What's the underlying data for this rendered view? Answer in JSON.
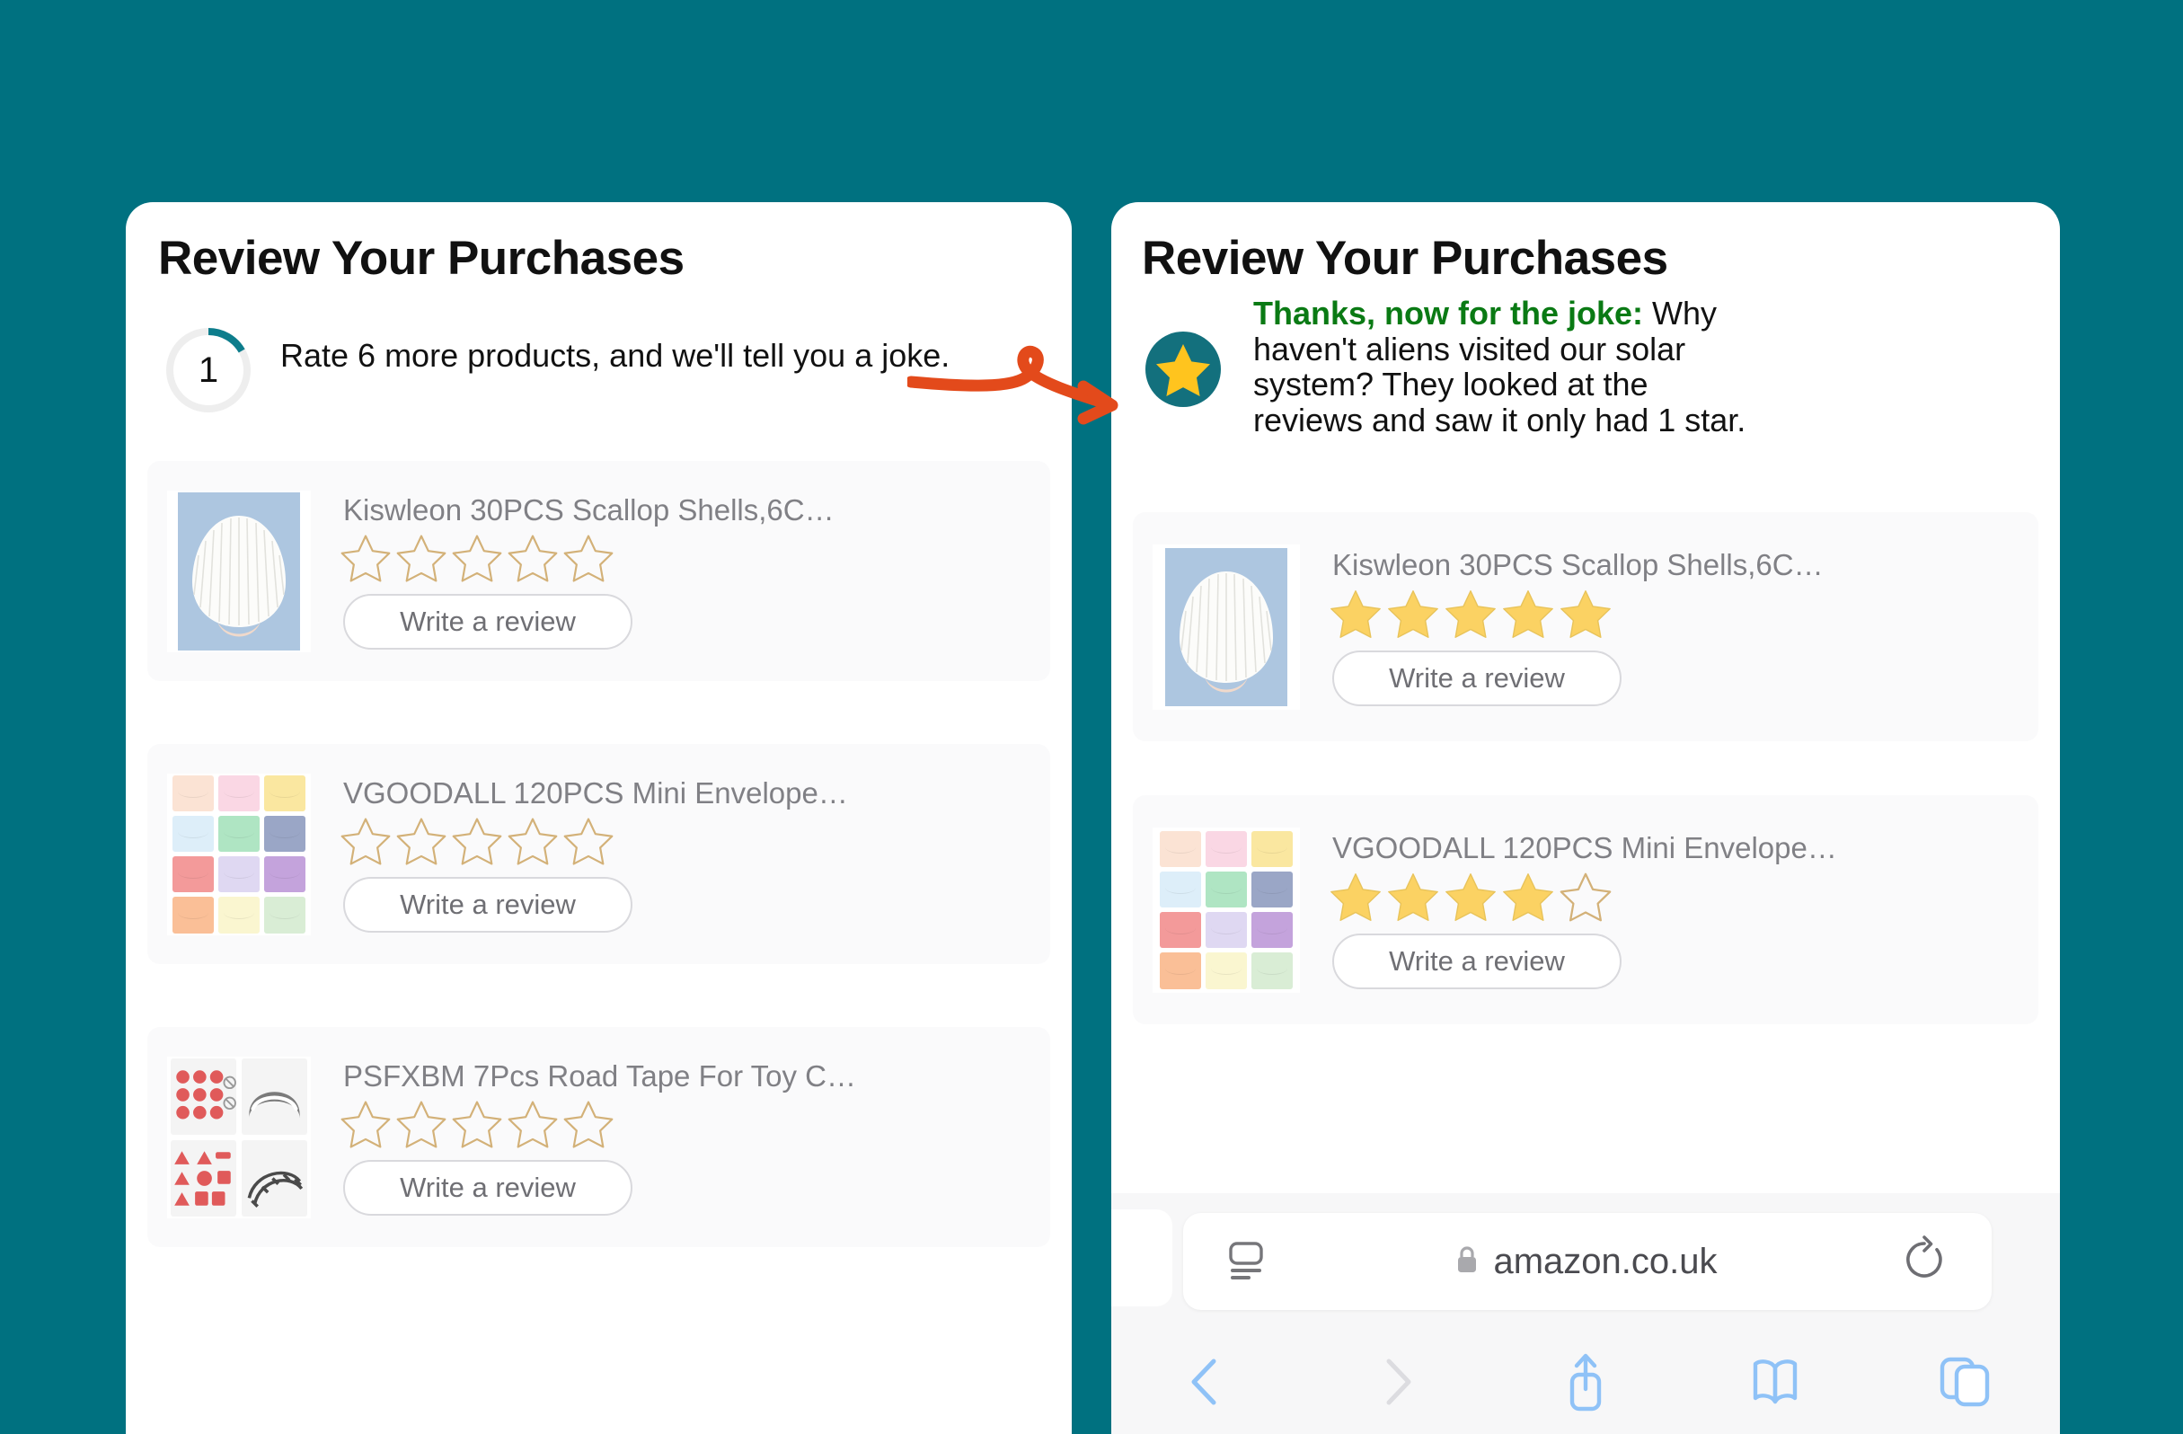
{
  "theme": {
    "background": "#007180",
    "card_background": "#ffffff",
    "item_background": "#FAFAFB",
    "progress_accent": "#0d7d8c",
    "progress_track": "#eeeeee",
    "star_filled": "#FBD263",
    "star_outline": "#D3B178",
    "joke_highlight": "#0a7a14",
    "annotation_arrow": "#E34A1B",
    "badge_circle": "#13707D",
    "badge_star": "#FFC41E",
    "safari_accent": "#8FC2F7"
  },
  "left_panel": {
    "title": "Review Your Purchases",
    "progress": {
      "value": "1",
      "percent": 14,
      "message": "Rate 6 more products, and we'll tell you a joke."
    },
    "products": [
      {
        "name": "Kiswleon 30PCS Scallop Shells,6C…",
        "rating": 0,
        "button": "Write a review",
        "thumb": "scallop-shell"
      },
      {
        "name": "VGOODALL 120PCS Mini Envelope…",
        "rating": 0,
        "button": "Write a review",
        "thumb": "mini-envelopes"
      },
      {
        "name": "PSFXBM 7Pcs Road Tape For Toy C…",
        "rating": 0,
        "button": "Write a review",
        "thumb": "road-tape"
      }
    ]
  },
  "right_panel": {
    "title": "Review Your Purchases",
    "joke": {
      "lead": "Thanks, now for the joke:",
      "body": " Why haven't aliens visited our solar system? They looked at the reviews and saw it only had 1 star."
    },
    "products": [
      {
        "name": "Kiswleon 30PCS Scallop Shells,6C…",
        "rating": 5,
        "button": "Write a review",
        "thumb": "scallop-shell"
      },
      {
        "name": "VGOODALL 120PCS Mini Envelope…",
        "rating": 4,
        "button": "Write a review",
        "thumb": "mini-envelopes"
      }
    ]
  },
  "browser": {
    "url": "amazon.co.uk",
    "secure": true,
    "icons": {
      "page_settings": "page-settings-icon",
      "lock": "lock-icon",
      "reload": "reload-icon",
      "back": "back-chevron-icon",
      "forward": "forward-chevron-icon",
      "share": "share-icon",
      "bookmarks": "bookmarks-icon",
      "tabs": "tabs-icon"
    },
    "back_enabled": true,
    "forward_enabled": false
  },
  "annotation": {
    "type": "curved-arrow",
    "from": "progress-counter",
    "to": "joke-star-badge"
  },
  "envelope_colors": [
    "#FBE3D4",
    "#FAD7E4",
    "#FAE7A0",
    "#DDEEF9",
    "#AFE5C3",
    "#9AA6C6",
    "#F39A9A",
    "#DFD8F2",
    "#C4A3DC",
    "#FABF97",
    "#FAF6D0",
    "#D9EDD5"
  ]
}
